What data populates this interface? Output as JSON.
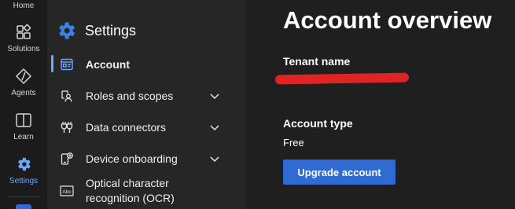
{
  "rail": {
    "items": [
      {
        "label": "Home",
        "icon": "home-icon"
      },
      {
        "label": "Solutions",
        "icon": "solutions-icon"
      },
      {
        "label": "Agents",
        "icon": "agents-icon"
      },
      {
        "label": "Learn",
        "icon": "learn-icon"
      },
      {
        "label": "Settings",
        "icon": "gear-icon",
        "active": true
      }
    ]
  },
  "panel": {
    "title": "Settings",
    "items": [
      {
        "label": "Account",
        "icon": "account-card-icon",
        "active": true
      },
      {
        "label": "Roles and scopes",
        "icon": "roles-icon",
        "expandable": true
      },
      {
        "label": "Data connectors",
        "icon": "plug-icon",
        "expandable": true
      },
      {
        "label": "Device onboarding",
        "icon": "device-add-icon",
        "expandable": true
      },
      {
        "label": "Optical character",
        "label2": "recognition (OCR)",
        "icon": "ocr-icon"
      }
    ]
  },
  "main": {
    "title": "Account overview",
    "tenant_label": "Tenant name",
    "type_label": "Account type",
    "type_value": "Free",
    "upgrade_button": "Upgrade account"
  },
  "colors": {
    "accent": "#6ea8ff",
    "button": "#2f6bd2",
    "redaction": "#e02323"
  }
}
